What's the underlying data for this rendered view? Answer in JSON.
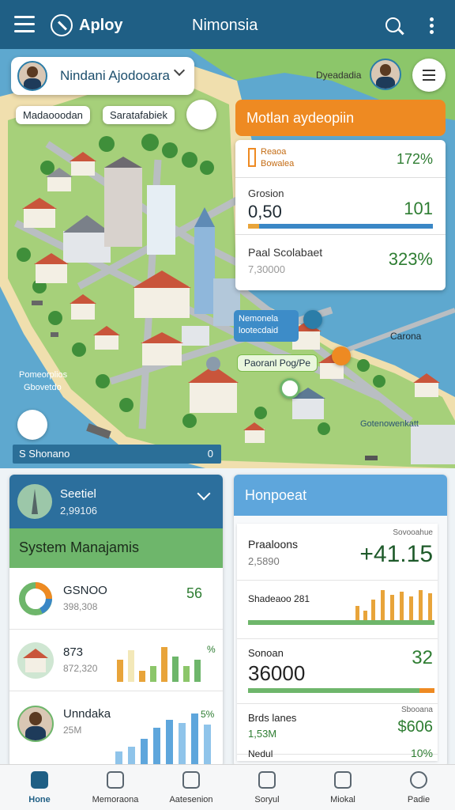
{
  "topbar": {
    "app_name": "Aploy",
    "title": "Nimonsia"
  },
  "map": {
    "location_chip": "Nindani Ajodooara",
    "tags": [
      "Madaooodan",
      "Saratafabiek"
    ],
    "user_label": "Dyeadadia",
    "overview_title": "Motlan aydeopiin",
    "stats": {
      "header_line1": "Reaoa",
      "header_line2": "Bowalea",
      "header_value": "172%",
      "row1_label": "Grosion",
      "row1_big": "0,50",
      "row1_value": "101",
      "row1_progress": 0.06,
      "row2_label": "Paal Scolabaet",
      "row2_sub": "7,30000",
      "row2_value": "323%"
    },
    "pin_tag_line1": "Nemonela",
    "pin_tag_line2": "lootecdaid",
    "place_tag": "Paoranl Pog/Pe",
    "label_right": "Carona",
    "label_left_line1": "Pomeorplios",
    "label_left_line2": "Gbovetdo",
    "label_bottom_right": "Gotenowenkatt",
    "footer_text": "S Shonano",
    "footer_zoom": "0"
  },
  "left_card": {
    "title": "Seetiel",
    "subtitle": "2,99106",
    "section": "System Manajamis",
    "rows": [
      {
        "name": "GSNOO",
        "sub": "398,308",
        "value": "56"
      },
      {
        "name": "873",
        "sub": "872,320",
        "value": "%"
      },
      {
        "name": "Unndaka",
        "sub": "25M",
        "value": "5%"
      }
    ]
  },
  "right_card": {
    "title": "Honpoeat",
    "rows": [
      {
        "label": "Praaloons",
        "sub": "2,5890",
        "value": "+41.15",
        "small": "Sovooahue"
      },
      {
        "label": "Shadeaoo 281",
        "sub": "",
        "value": "",
        "small": ""
      },
      {
        "label": "Sonoan",
        "sub": "36000",
        "value": "32",
        "small": ""
      },
      {
        "label": "Brds lanes",
        "sub": "1,53M",
        "value": "$606",
        "small": "Sbooana"
      },
      {
        "label": "Nedul",
        "sub": "",
        "value": "10%",
        "small": ""
      }
    ]
  },
  "bottom_nav": [
    "Hone",
    "Memoraona",
    "Aatesenion",
    "Soryul",
    "Miokal",
    "Padie"
  ],
  "colors": {
    "primary": "#1f5f85",
    "accent": "#ee8a22",
    "green": "#6eb66b",
    "blue": "#5ea6dc"
  }
}
